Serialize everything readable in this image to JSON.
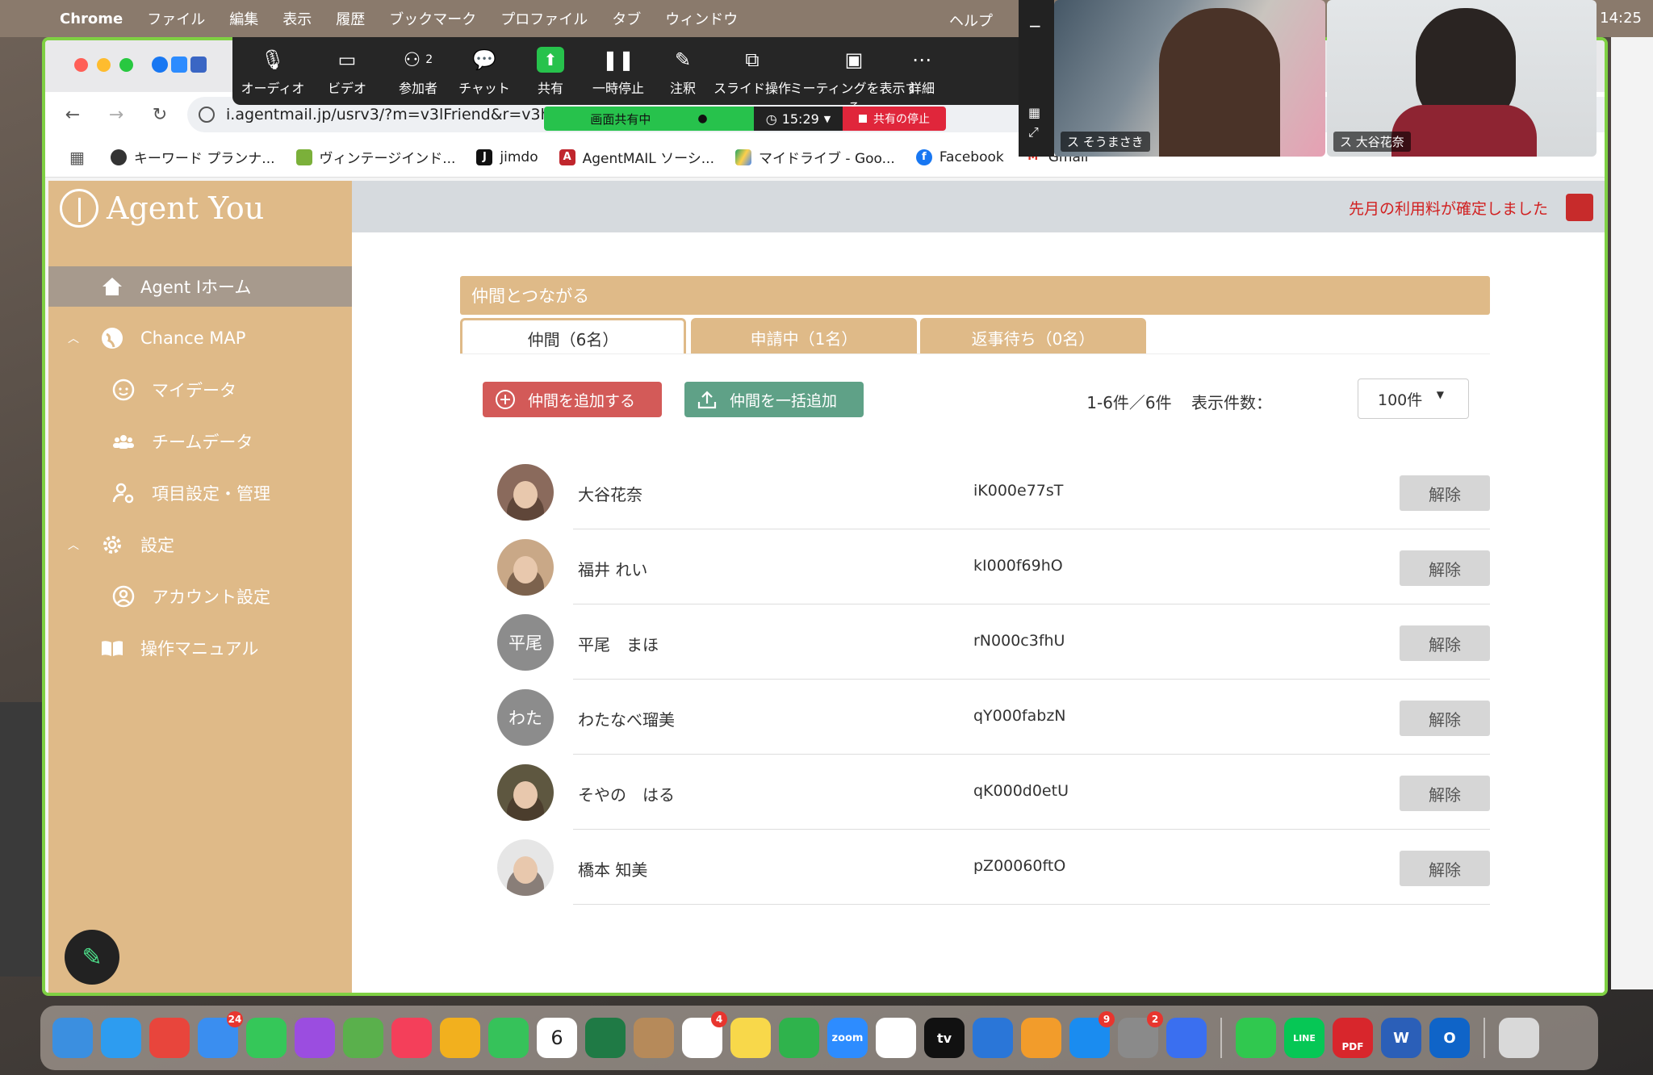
{
  "menubar": {
    "app": "Chrome",
    "items": [
      "ファイル",
      "編集",
      "表示",
      "履歴",
      "ブックマーク",
      "プロファイル",
      "タブ",
      "ウィンドウ"
    ],
    "help": "ヘルプ",
    "clock": "14:25"
  },
  "browser": {
    "url": "i.agentmail.jp/usrv3/?m=v3lFriend&r=v3hor",
    "bookmarks": [
      {
        "label": "キーワード プランナ...",
        "icon": "globe-icon"
      },
      {
        "label": "ヴィンテージインド...",
        "icon": "leaf-icon"
      },
      {
        "label": "jimdo",
        "icon": "jimdo-icon"
      },
      {
        "label": "AgentMAIL ソーシ...",
        "icon": "agentmail-icon"
      },
      {
        "label": "マイドライブ - Goo...",
        "icon": "drive-icon"
      },
      {
        "label": "Facebook",
        "icon": "facebook-icon"
      },
      {
        "label": "Gmail",
        "icon": "gmail-icon"
      }
    ]
  },
  "zoom": {
    "toolbar": [
      {
        "label": "オーディオ",
        "icon": "microphone-icon"
      },
      {
        "label": "ビデオ",
        "icon": "video-camera-icon"
      },
      {
        "label": "参加者",
        "icon": "participants-icon",
        "count": "2"
      },
      {
        "label": "チャット",
        "icon": "chat-icon"
      },
      {
        "label": "共有",
        "icon": "share-arrow-icon"
      },
      {
        "label": "一時停止",
        "icon": "pause-icon"
      },
      {
        "label": "注釈",
        "icon": "pencil-icon"
      },
      {
        "label": "スライド操作",
        "icon": "slide-control-icon"
      },
      {
        "label": "ミーティングを表示する",
        "icon": "show-meeting-icon"
      },
      {
        "label": "詳細",
        "icon": "more-icon"
      }
    ],
    "share_status": "画面共有中",
    "timer": "15:29",
    "stop_share": "共有の停止",
    "participants": [
      {
        "name": "ス そうまさき"
      },
      {
        "name": "ス 大谷花奈"
      }
    ]
  },
  "sidebar": {
    "logo": "Agent You",
    "items": [
      {
        "label": "Agent Iホーム",
        "icon": "home-icon"
      },
      {
        "label": "Chance MAP",
        "icon": "globe-icon"
      },
      {
        "label": "マイデータ",
        "icon": "face-icon"
      },
      {
        "label": "チームデータ",
        "icon": "team-icon"
      },
      {
        "label": "項目設定・管理",
        "icon": "user-settings-icon"
      },
      {
        "label": "設定",
        "icon": "gear-icon"
      },
      {
        "label": "アカウント設定",
        "icon": "account-icon"
      },
      {
        "label": "操作マニュアル",
        "icon": "book-icon"
      }
    ]
  },
  "notice": "先月の利用料が確定しました",
  "main": {
    "title": "仲間とつながる",
    "tabs": [
      "仲間（6名）",
      "申請中（1名）",
      "返事待ち（0名）"
    ],
    "add_button": "仲間を追加する",
    "bulk_button": "仲間を一括追加",
    "count_text": "1-6件／6件",
    "per_page_label": "表示件数：",
    "per_page_value": "100件",
    "remove_label": "解除",
    "members": [
      {
        "name": "大谷花奈",
        "id": "iK000e77sT",
        "avatar": "photo",
        "color": "#8a6a5c"
      },
      {
        "name": "福井 れい",
        "id": "kI000f69hO",
        "avatar": "photo",
        "color": "#c9a887"
      },
      {
        "name": "平尾　まほ",
        "id": "rN000c3fhU",
        "avatar": "平尾",
        "color": "#8c8c8c"
      },
      {
        "name": "わたなべ瑠美",
        "id": "qY000fabzN",
        "avatar": "わた",
        "color": "#8c8c8c"
      },
      {
        "name": "そやの　はる",
        "id": "qK000d0etU",
        "avatar": "photo",
        "color": "#5e5740"
      },
      {
        "name": "橋本 知美",
        "id": "pZ00060ftO",
        "avatar": "photo",
        "color": "#e6e6e6"
      }
    ]
  },
  "dock": {
    "badges": {
      "mail": "24",
      "calendar_month": "6月",
      "calendar_day": "6",
      "reminders": "4",
      "appstore": "9",
      "settings": "2"
    },
    "zoom_label": "zoom",
    "tv_label": "tv",
    "line_label": "LINE",
    "pdf_label": "PDF",
    "word_label": "W",
    "outlook_label": "O"
  },
  "colors": {
    "sidebar": "#dfba88",
    "red_button": "#d35a58",
    "green_button": "#5fa187",
    "active_nav": "#a79a8d",
    "window_border": "#7fd043"
  }
}
